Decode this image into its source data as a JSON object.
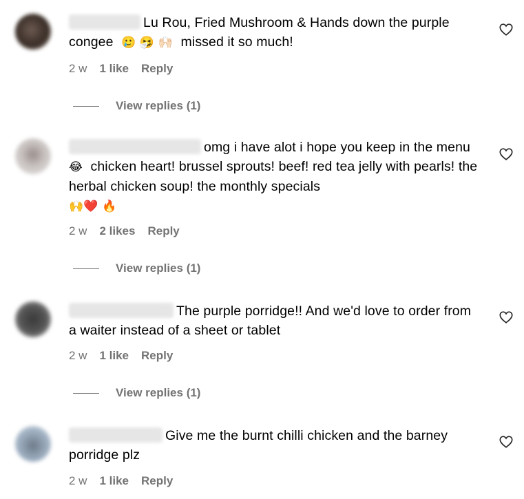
{
  "comments": [
    {
      "text": "Lu Rou, Fried Mushroom & Hands down the purple congee",
      "emojis": [
        "🥲",
        "🤧",
        "🙌🏻"
      ],
      "text_after": "missed it so much!",
      "time": "2 w",
      "likes": "1 like",
      "reply": "Reply",
      "view_replies": "View replies (1)"
    },
    {
      "text": "omg i have alot i hope you keep in the menu",
      "emoji_inline": "😂",
      "text_after": "chicken heart! brussel sprouts! beef! red tea jelly with pearls! the herbal chicken soup! the monthly specials",
      "emojis": [
        "🙌",
        "❤️",
        "🔥"
      ],
      "time": "2 w",
      "likes": "2 likes",
      "reply": "Reply",
      "view_replies": "View replies (1)"
    },
    {
      "text": "The purple porridge!! And we'd love to order from a waiter instead of a sheet or tablet",
      "time": "2 w",
      "likes": "1 like",
      "reply": "Reply",
      "view_replies": "View replies (1)"
    },
    {
      "text": "Give me the burnt chilli chicken and the barney porridge plz",
      "time": "2 w",
      "likes": "1 like",
      "reply": "Reply"
    }
  ],
  "icons": {
    "like": "heart-outline-icon"
  },
  "colors": {
    "meta_text": "#737373",
    "body_text": "#000000"
  }
}
